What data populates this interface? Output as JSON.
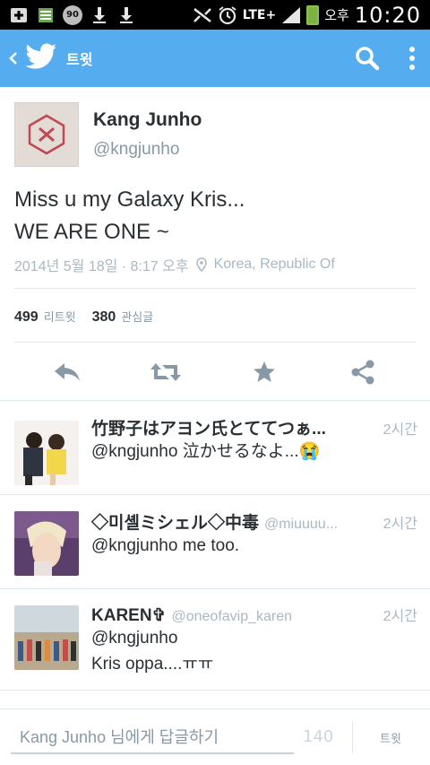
{
  "status_bar": {
    "network": "LTE+",
    "notification_count": "90",
    "ampm": "오후",
    "time": "10:20"
  },
  "app_bar": {
    "title": "트윗",
    "accent_color": "#55acee"
  },
  "tweet": {
    "author_name": "Kang Junho",
    "author_handle": "@kngjunho",
    "text_line1": "Miss u my Galaxy Kris...",
    "text_line2": "WE ARE ONE ~",
    "timestamp": "2014년 5월 18일 · 8:17 오후",
    "location": "Korea, Republic Of",
    "retweets": "499",
    "retweets_label": "리트윗",
    "favorites": "380",
    "favorites_label": "관심글"
  },
  "replies": [
    {
      "name": "竹野子はアヨン氏とててつぁ...",
      "handle": "",
      "time": "2시간",
      "text": "@kngjunho 泣かせるなよ...😭"
    },
    {
      "name": "◇미셸ミシェル◇中毒",
      "handle": "@miuuuu...",
      "time": "2시간",
      "text": "@kngjunho me too."
    },
    {
      "name": "KAREN✞",
      "handle": "@oneofavip_karen",
      "time": "2시간",
      "text_line1": "@kngjunho",
      "text_line2": "Kris oppa....ㅠㅠ"
    }
  ],
  "composer": {
    "placeholder": "Kang Junho 님에게 답글하기",
    "char_count": "140",
    "tweet_button": "트윗"
  },
  "icons": [
    "back-chevron-icon",
    "twitter-bird-icon",
    "search-icon",
    "overflow-menu-icon",
    "location-pin-icon",
    "reply-icon",
    "retweet-icon",
    "favorite-star-icon",
    "share-icon"
  ]
}
